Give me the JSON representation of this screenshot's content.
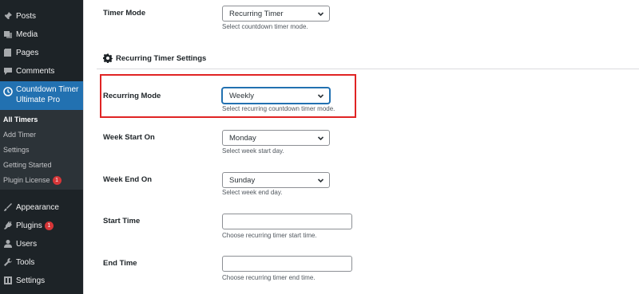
{
  "sidebar": {
    "posts": "Posts",
    "media": "Media",
    "pages": "Pages",
    "comments": "Comments",
    "current_line1": "Countdown Timer",
    "current_line2": "Ultimate Pro",
    "sub_all_timers": "All Timers",
    "sub_add_timer": "Add Timer",
    "sub_settings": "Settings",
    "sub_getting_started": "Getting Started",
    "sub_plugin_license": "Plugin License",
    "sub_plugin_license_badge": "1",
    "appearance": "Appearance",
    "plugins": "Plugins",
    "plugins_badge": "1",
    "users": "Users",
    "tools": "Tools",
    "settings": "Settings"
  },
  "form": {
    "timer_mode_label": "Timer Mode",
    "timer_mode_value": "Recurring Timer",
    "timer_mode_desc": "Select countdown timer mode.",
    "section_title": "Recurring Timer Settings",
    "recurring_mode_label": "Recurring Mode",
    "recurring_mode_value": "Weekly",
    "recurring_mode_desc": "Select recurring countdown timer mode.",
    "week_start_label": "Week Start On",
    "week_start_value": "Monday",
    "week_start_desc": "Select week start day.",
    "week_end_label": "Week End On",
    "week_end_value": "Sunday",
    "week_end_desc": "Select week end day.",
    "start_time_label": "Start Time",
    "start_time_value": "",
    "start_time_desc": "Choose recurring timer start time.",
    "end_time_label": "End Time",
    "end_time_value": "",
    "end_time_desc": "Choose recurring timer end time."
  },
  "colors": {
    "sidebar_bg": "#1d2327",
    "submenu_bg": "#2c3338",
    "accent": "#2271b1",
    "badge": "#d63638",
    "highlight": "#e02424"
  },
  "icons": {
    "posts": "pin-icon",
    "media": "media-icon",
    "pages": "pages-icon",
    "comments": "comment-icon",
    "current": "clock-icon",
    "appearance": "paintbrush-icon",
    "plugins": "plug-icon",
    "users": "user-icon",
    "tools": "wrench-icon",
    "settings": "settings-icon",
    "section": "gear-icon"
  }
}
